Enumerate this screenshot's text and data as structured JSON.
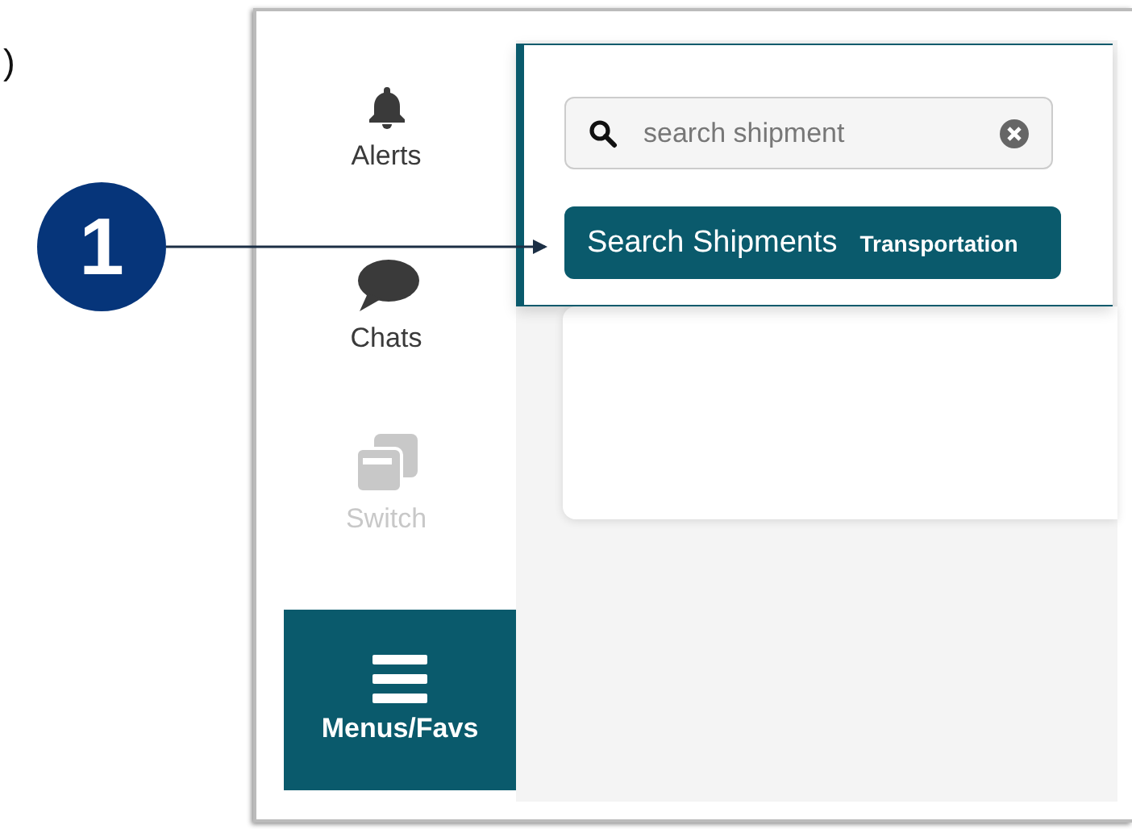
{
  "annotation": {
    "text": ")"
  },
  "callout": {
    "number": "1"
  },
  "sidebar": {
    "items": [
      {
        "kind": "bell",
        "label": "Alerts",
        "selected": false,
        "disabled": false
      },
      {
        "kind": "chat",
        "label": "Chats",
        "selected": false,
        "disabled": false
      },
      {
        "kind": "switch",
        "label": "Switch",
        "selected": false,
        "disabled": true
      },
      {
        "kind": "menu",
        "label": "Menus/Favs",
        "selected": true,
        "disabled": false
      }
    ]
  },
  "search": {
    "value": "search shipment"
  },
  "results": [
    {
      "title": "Search Shipments",
      "category": "Transportation",
      "selected": true
    }
  ]
}
